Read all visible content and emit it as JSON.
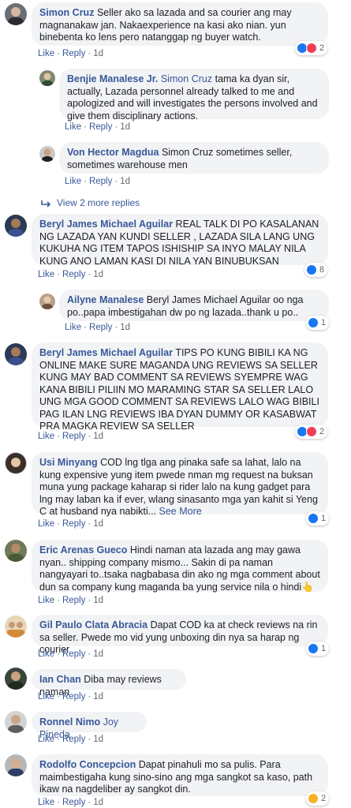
{
  "actions": {
    "like": "Like",
    "reply": "Reply",
    "sep": "·"
  },
  "comments": [
    {
      "author": "Simon Cruz",
      "text": "Seller ako sa lazada and sa courier ang may magnanakaw jan. Nakaexperience na kasi ako nian. yun binebenta ko lens pero natanggap ng buyer watch.",
      "time": "1d",
      "reactions": "2"
    },
    {
      "author": "Benjie Manalese Jr.",
      "mention": "Simon Cruz",
      "text": " tama ka dyan sir, actually, Lazada personnel already talked to me and apologized and will investigates the persons involved and give them disciplinary actions.",
      "time": "1d"
    },
    {
      "author": "Von Hector Magdua",
      "text": "Simon Cruz sometimes seller, sometimes warehouse men",
      "time": "1d"
    },
    {
      "author": "Beryl James Michael Aguilar",
      "text": "REAL TALK DI PO KASALANAN NG LAZADA YAN KUNDI SELLER , LAZADA SILA LANG UNG KUKUHA NG ITEM TAPOS ISHISHIP SA INYO MALAY NILA KUNG ANO LAMAN KASI DI NILA YAN BINUBUKSAN",
      "time": "1d",
      "reactions": "8"
    },
    {
      "author": "Ailyne Manalese",
      "text": "Beryl James Michael Aguilar oo nga po..papa imbestigahan dw po ng lazada..thank u po..",
      "time": "1d",
      "reactions": "1"
    },
    {
      "author": "Beryl James Michael Aguilar",
      "text": "TIPS PO KUNG BIBILI KA NG ONLINE MAKE SURE MAGANDA UNG REVIEWS SA SELLER KUNG MAY BAD COMMENT SA REVIEWS SYEMPRE WAG KANA BIBILI PILIIN MO MARAMING STAR SA SELLER LALO UNG MGA GOOD COMMENT SA REVIEWS LALO WAG BIBILI PAG ILAN LNG REVIEWS IBA DYAN DUMMY OR KASABWAT PRA MAGKA REVIEW SA SELLER",
      "time": "1d",
      "reactions": "2"
    },
    {
      "author": "Usi Minyang",
      "text": "COD lng tlga ang pinaka safe sa lahat, lalo na kung expensive yung item pwede nman mg request na buksan muna yung package kaharap si rider lalo na kung gadget para lng may laban ka if ever, wlang sinasanto mga yan kahit si Yeng C at husband nya nabikti...",
      "see_more": "See More",
      "time": "1d",
      "reactions": "1"
    },
    {
      "author": "Eric Arenas Gueco",
      "text": "Hindi naman ata lazada ang may gawa nyan.. shipping company mismo... Sakin di pa naman nangyayari to..tsaka nagbabasa din ako ng mga comment about dun sa company kung maganda ba yung service nila o hindi👆",
      "time": "1d"
    },
    {
      "author": "Gil Paulo Clata Abracia",
      "text": "Dapat COD ka at check reviews na rin sa seller. Pwede mo vid yung unboxing din nya sa harap ng courier",
      "time": "1d",
      "reactions": "1"
    },
    {
      "author": "Ian Chan",
      "text": "Diba may reviews naman",
      "time": "1d"
    },
    {
      "author": "Ronnel Nimo",
      "mention": "Joy Pineda",
      "text": "",
      "time": "1d"
    },
    {
      "author": "Rodolfo Concepcion",
      "text": "Dapat pinahuli mo sa pulis. Para maimbestigaha kung sino-sino ang mga sangkot sa kaso, path ikaw na nagdeliber ay sangkot din.",
      "time": "1d",
      "reactions": "2"
    }
  ],
  "view_more": "View 2 more replies",
  "reply_icon": "reply-arrow-icon",
  "colors": {
    "link": "#385898",
    "bubble": "#f2f3f5",
    "like": "#1877f2",
    "love": "#f33e58"
  }
}
